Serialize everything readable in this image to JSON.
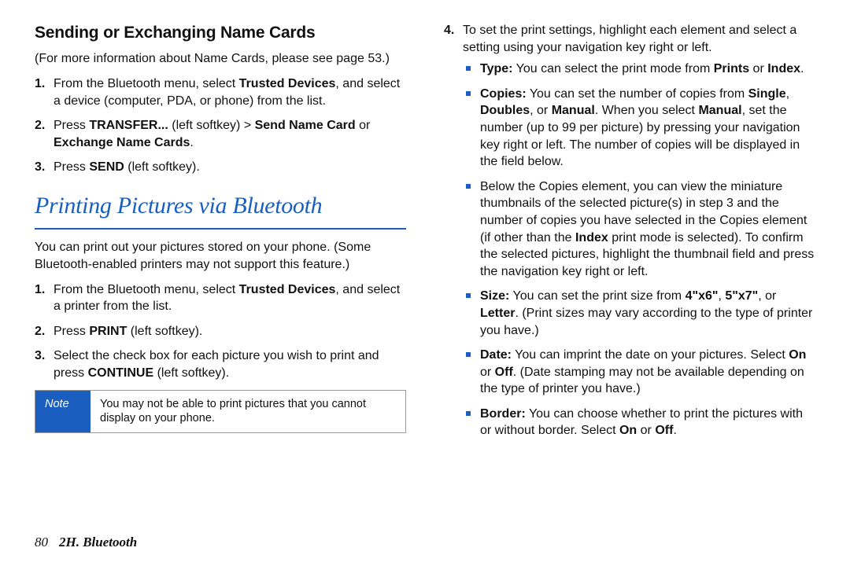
{
  "left": {
    "heading": "Sending or Exchanging Name Cards",
    "intro": "(For more information about Name Cards, please see page 53.)",
    "steps": [
      {
        "n": "1.",
        "pre": "From the Bluetooth menu, select ",
        "b1": "Trusted Devices",
        "post": ", and select a device (computer, PDA, or phone) from the list."
      },
      {
        "n": "2.",
        "pre": "Press ",
        "b1": "TRANSFER...",
        "mid1": " (left softkey) > ",
        "b2": "Send Name Card",
        "mid2": " or ",
        "b3": "Exchange Name Cards",
        "post": "."
      },
      {
        "n": "3.",
        "pre": "Press ",
        "b1": "SEND",
        "post": " (left softkey)."
      }
    ],
    "sectionTitle": "Printing Pictures via Bluetooth",
    "printIntro": "You can print out your pictures stored on your phone. (Some Bluetooth-enabled printers may not support this feature.)",
    "printSteps": [
      {
        "n": "1.",
        "pre": "From the Bluetooth menu, select ",
        "b1": "Trusted Devices",
        "post": ", and select a printer from the list."
      },
      {
        "n": "2.",
        "pre": "Press ",
        "b1": "PRINT",
        "post": " (left softkey)."
      },
      {
        "n": "3.",
        "pre": "Select the check box for each picture you wish to print and press ",
        "b1": "CONTINUE",
        "post": " (left softkey)."
      }
    ],
    "noteLabel": "Note",
    "noteText": "You may not be able to print pictures that you cannot display on your phone."
  },
  "right": {
    "step4": {
      "n": "4.",
      "text": "To set the print settings, highlight each element and select a setting using your navigation key right or left."
    },
    "bullets": {
      "type": {
        "label": "Type:",
        "pre": " You can select the print mode from ",
        "b1": "Prints",
        "mid": " or ",
        "b2": "Index",
        "post": "."
      },
      "copies": {
        "label": "Copies:",
        "pre": " You can set the number of copies from ",
        "b1": "Single",
        "c1": ", ",
        "b2": "Doubles",
        "c2": ", or ",
        "b3": "Manual",
        "c3": ". When you select ",
        "b4": "Manual",
        "post": ", set the number (up to 99 per picture) by pressing your navigation key right or left. The number of copies will be displayed in the field below."
      },
      "thumb": {
        "pre": "Below the Copies element, you can view the miniature thumbnails of the selected picture(s) in step 3 and the number of copies you have selected in the Copies element (if other than the ",
        "b1": "Index",
        "post": " print mode is selected). To confirm the selected pictures, highlight the thumbnail field and press the navigation key right or left."
      },
      "size": {
        "label": "Size:",
        "pre": " You can set the print size from ",
        "b1": "4\"x6\"",
        "c1": ", ",
        "b2": "5\"x7\"",
        "c2": ", or ",
        "b3": "Letter",
        "post": ". (Print sizes may vary according to the type of printer you have.)"
      },
      "date": {
        "label": "Date:",
        "pre": " You can imprint the date on your pictures. Select ",
        "b1": "On",
        "c1": " or ",
        "b2": "Off",
        "post": ". (Date stamping may not be available depending on the type of printer you have.)"
      },
      "border": {
        "label": "Border:",
        "pre": " You can choose whether to print the pictures with or without border. Select ",
        "b1": "On",
        "c1": " or ",
        "b2": "Off",
        "post": "."
      }
    }
  },
  "footer": {
    "page": "80",
    "text": "2H. Bluetooth"
  }
}
